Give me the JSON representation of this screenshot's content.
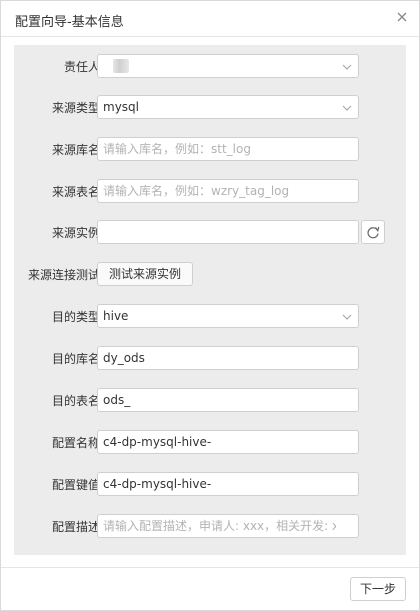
{
  "dialog": {
    "title": "配置向导-基本信息",
    "close_icon": "close-icon"
  },
  "form": {
    "owner": {
      "label": "责任人:",
      "value": ""
    },
    "source_type": {
      "label": "来源类型:",
      "value": "mysql"
    },
    "source_db": {
      "label": "来源库名:",
      "value": "",
      "placeholder": "请输入库名，例如：stt_log"
    },
    "source_table": {
      "label": "来源表名:",
      "value": "",
      "placeholder": "请输入库名，例如：wzry_tag_log"
    },
    "source_instance": {
      "label": "来源实例:",
      "value": "",
      "refresh_icon": "refresh-icon"
    },
    "connection_test": {
      "label": "来源连接测试:",
      "button": "测试来源实例"
    },
    "target_type": {
      "label": "目的类型:",
      "value": "hive"
    },
    "target_db": {
      "label": "目的库名:",
      "value": "dy_ods"
    },
    "target_table": {
      "label": "目的表名:",
      "value": "ods_"
    },
    "config_name": {
      "label": "配置名称:",
      "value": "c4-dp-mysql-hive-"
    },
    "config_key": {
      "label": "配置键值:",
      "value": "c4-dp-mysql-hive-"
    },
    "config_desc": {
      "label": "配置描述:",
      "value": "",
      "placeholder": "请输入配置描述，申请人: xxx，相关开发: xxx"
    }
  },
  "footer": {
    "next_label": "下一步"
  }
}
